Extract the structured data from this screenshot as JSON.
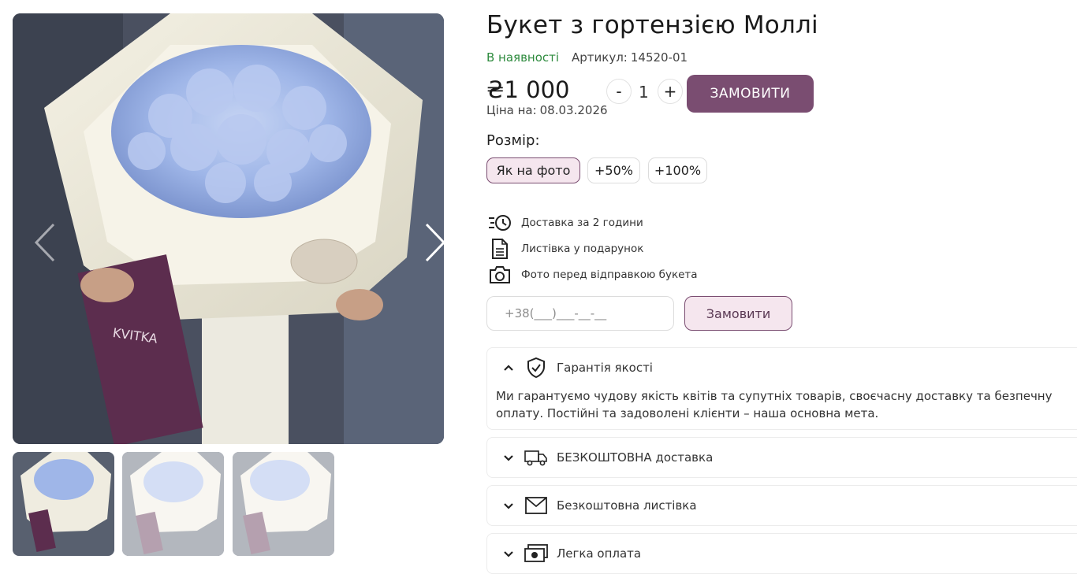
{
  "product": {
    "title": "Букет з гортензією Моллі",
    "availability": "В наявності",
    "sku_label": "Артикул:",
    "sku_value": "14520-01",
    "price": "₴1 000",
    "price_date_label": "Ціна на:",
    "price_date": "08.03.2026"
  },
  "quantity": {
    "minus": "-",
    "value": "1",
    "plus": "+"
  },
  "order_button": "ЗАМОВИТИ",
  "size": {
    "label": "Розмір:",
    "options": [
      "Як на фото",
      "+50%",
      "+100%"
    ],
    "selected": "Як на фото"
  },
  "features": [
    {
      "icon": "delivery-clock-icon",
      "text": "Доставка за 2 години"
    },
    {
      "icon": "document-icon",
      "text": "Листівка у подарунок"
    },
    {
      "icon": "camera-icon",
      "text": "Фото перед відправкою букета"
    }
  ],
  "quick_order": {
    "placeholder": "+38(___)___-__-__",
    "button": "Замовити"
  },
  "accordion": [
    {
      "icon": "shield-check-icon",
      "title": "Гарантія якості",
      "expanded": true,
      "body": "Ми гарантуємо чудову якість квітів та супутніх товарів, своєчасну доставку та безпечну оплату. Постійні та задоволені клієнти – наша основна мета."
    },
    {
      "icon": "truck-icon",
      "title": "БЕЗКОШТОВНА доставка",
      "expanded": false
    },
    {
      "icon": "envelope-icon",
      "title": "Безкоштовна листівка",
      "expanded": false
    },
    {
      "icon": "money-icon",
      "title": "Легка оплата",
      "expanded": false
    }
  ],
  "gallery": {
    "thumbnail_count": 3,
    "active_thumbnail": 1,
    "tag_text": "KVITKA"
  },
  "colors": {
    "accent": "#7a4d71",
    "accent_light": "#f5e6ee",
    "in_stock": "#2e8b3e",
    "hydrangea": "#9fb6e8"
  }
}
